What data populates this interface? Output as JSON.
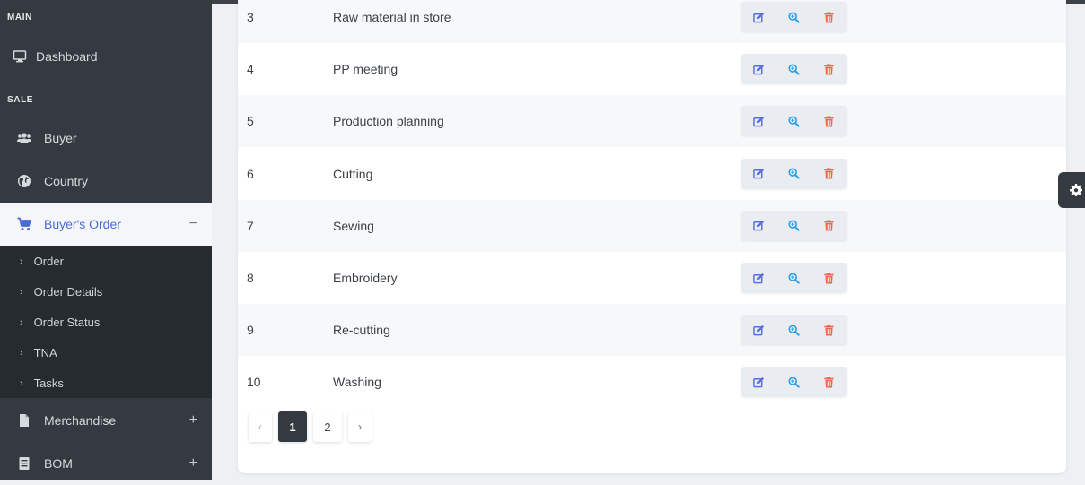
{
  "sidebar": {
    "sections": {
      "main": "MAIN",
      "sale": "SALE"
    },
    "items": {
      "dashboard": "Dashboard",
      "buyer": "Buyer",
      "country": "Country",
      "buyers_order": "Buyer's Order",
      "merchandise": "Merchandise",
      "bom": "BOM"
    },
    "signs": {
      "buyers_order": "−",
      "merchandise": "+",
      "bom": "+"
    },
    "submenu": [
      "Order",
      "Order Details",
      "Order Status",
      "TNA",
      "Tasks"
    ],
    "chevron": "›"
  },
  "table": {
    "rows": [
      {
        "num": "3",
        "name": "Raw material in store"
      },
      {
        "num": "4",
        "name": "PP meeting"
      },
      {
        "num": "5",
        "name": "Production planning"
      },
      {
        "num": "6",
        "name": "Cutting"
      },
      {
        "num": "7",
        "name": "Sewing"
      },
      {
        "num": "8",
        "name": "Embroidery"
      },
      {
        "num": "9",
        "name": "Re-cutting"
      },
      {
        "num": "10",
        "name": "Washing"
      }
    ]
  },
  "pagination": {
    "prev": "‹",
    "pages": [
      "1",
      "2"
    ],
    "current": "1",
    "next": "›"
  },
  "colors": {
    "sidebar_bg": "#343a40",
    "submenu_bg": "#262b30",
    "active_text": "#4a6bd6",
    "edit_icon": "#5b6fe0",
    "view_icon": "#2f9fe6",
    "delete_icon": "#f0654f"
  },
  "icons": {
    "dashboard": "monitor-icon",
    "buyer": "users-icon",
    "country": "globe-icon",
    "buyers_order": "cart-icon",
    "merchandise": "file-icon",
    "bom": "list-icon",
    "settings": "gear-icon"
  }
}
